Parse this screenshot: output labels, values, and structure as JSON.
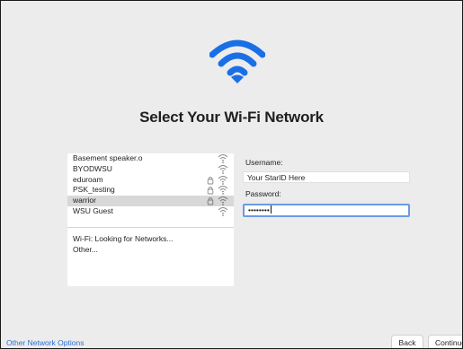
{
  "title": "Select Your Wi-Fi Network",
  "networks": [
    {
      "name": "Basement speaker.o",
      "locked": false
    },
    {
      "name": "BYODWSU",
      "locked": false
    },
    {
      "name": "eduroam",
      "locked": true
    },
    {
      "name": "PSK_testing",
      "locked": true
    },
    {
      "name": "warrior",
      "locked": true,
      "selected": true
    },
    {
      "name": "WSU Guest",
      "locked": false
    }
  ],
  "status": "Wi-Fi: Looking for Networks...",
  "other": "Other...",
  "form": {
    "username_label": "Username:",
    "username_value": "Your StarID Here",
    "password_label": "Password:",
    "password_value": "••••••••"
  },
  "footer": {
    "other_options": "Other Network Options",
    "back": "Back",
    "continue": "Continue"
  },
  "colors": {
    "accent": "#1b6fe6",
    "link": "#2f6fd0",
    "selection": "#d8d8d8"
  }
}
